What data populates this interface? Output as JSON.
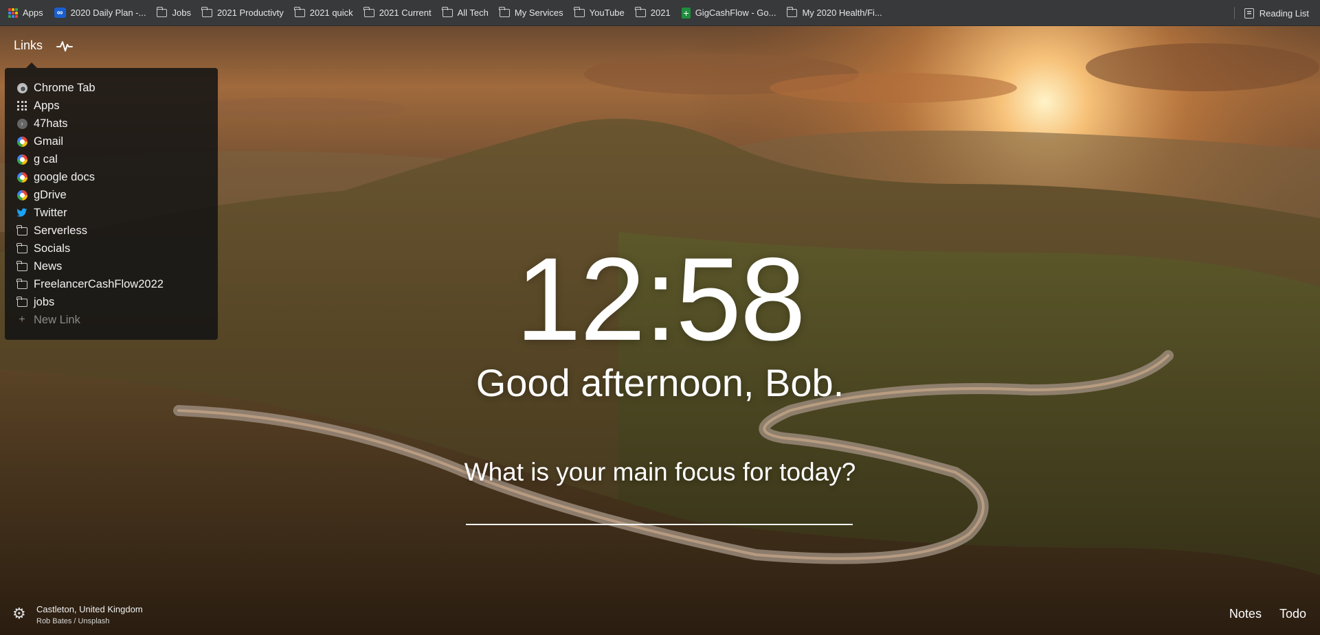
{
  "bookmarks_bar": {
    "items": [
      {
        "label": "Apps",
        "icon": "apps-grid-icon"
      },
      {
        "label": "2020 Daily Plan -...",
        "icon": "infinity-icon"
      },
      {
        "label": "Jobs",
        "icon": "folder-icon"
      },
      {
        "label": "2021 Productivty",
        "icon": "folder-icon"
      },
      {
        "label": "2021 quick",
        "icon": "folder-icon"
      },
      {
        "label": "2021 Current",
        "icon": "folder-icon"
      },
      {
        "label": "All Tech",
        "icon": "folder-icon"
      },
      {
        "label": "My Services",
        "icon": "folder-icon"
      },
      {
        "label": "YouTube",
        "icon": "folder-icon"
      },
      {
        "label": "2021",
        "icon": "folder-icon"
      },
      {
        "label": "GigCashFlow - Go...",
        "icon": "sheets-icon"
      },
      {
        "label": "My 2020 Health/Fi...",
        "icon": "folder-icon"
      }
    ],
    "reading_list": "Reading List"
  },
  "links": {
    "header": "Links",
    "items": [
      {
        "label": "Chrome Tab",
        "icon": "chrome-icon"
      },
      {
        "label": "Apps",
        "icon": "apps-icon"
      },
      {
        "label": "47hats",
        "icon": "arrow-circle-icon"
      },
      {
        "label": "Gmail",
        "icon": "google-icon"
      },
      {
        "label": "g cal",
        "icon": "google-icon"
      },
      {
        "label": "google docs",
        "icon": "google-icon"
      },
      {
        "label": "gDrive",
        "icon": "google-icon"
      },
      {
        "label": "Twitter",
        "icon": "twitter-icon"
      },
      {
        "label": "Serverless",
        "icon": "folder-icon"
      },
      {
        "label": "Socials",
        "icon": "folder-icon"
      },
      {
        "label": "News",
        "icon": "folder-icon"
      },
      {
        "label": "FreelancerCashFlow2022",
        "icon": "folder-icon"
      },
      {
        "label": "jobs",
        "icon": "folder-icon"
      }
    ],
    "new_link": "New Link"
  },
  "main": {
    "time": "12:58",
    "greeting": "Good afternoon, Bob.",
    "focus_question": "What is your main focus for today?",
    "focus_value": ""
  },
  "photo": {
    "location": "Castleton, United Kingdom",
    "credit": "Rob Bates / Unsplash"
  },
  "bottom_right": {
    "notes": "Notes",
    "todo": "Todo"
  }
}
